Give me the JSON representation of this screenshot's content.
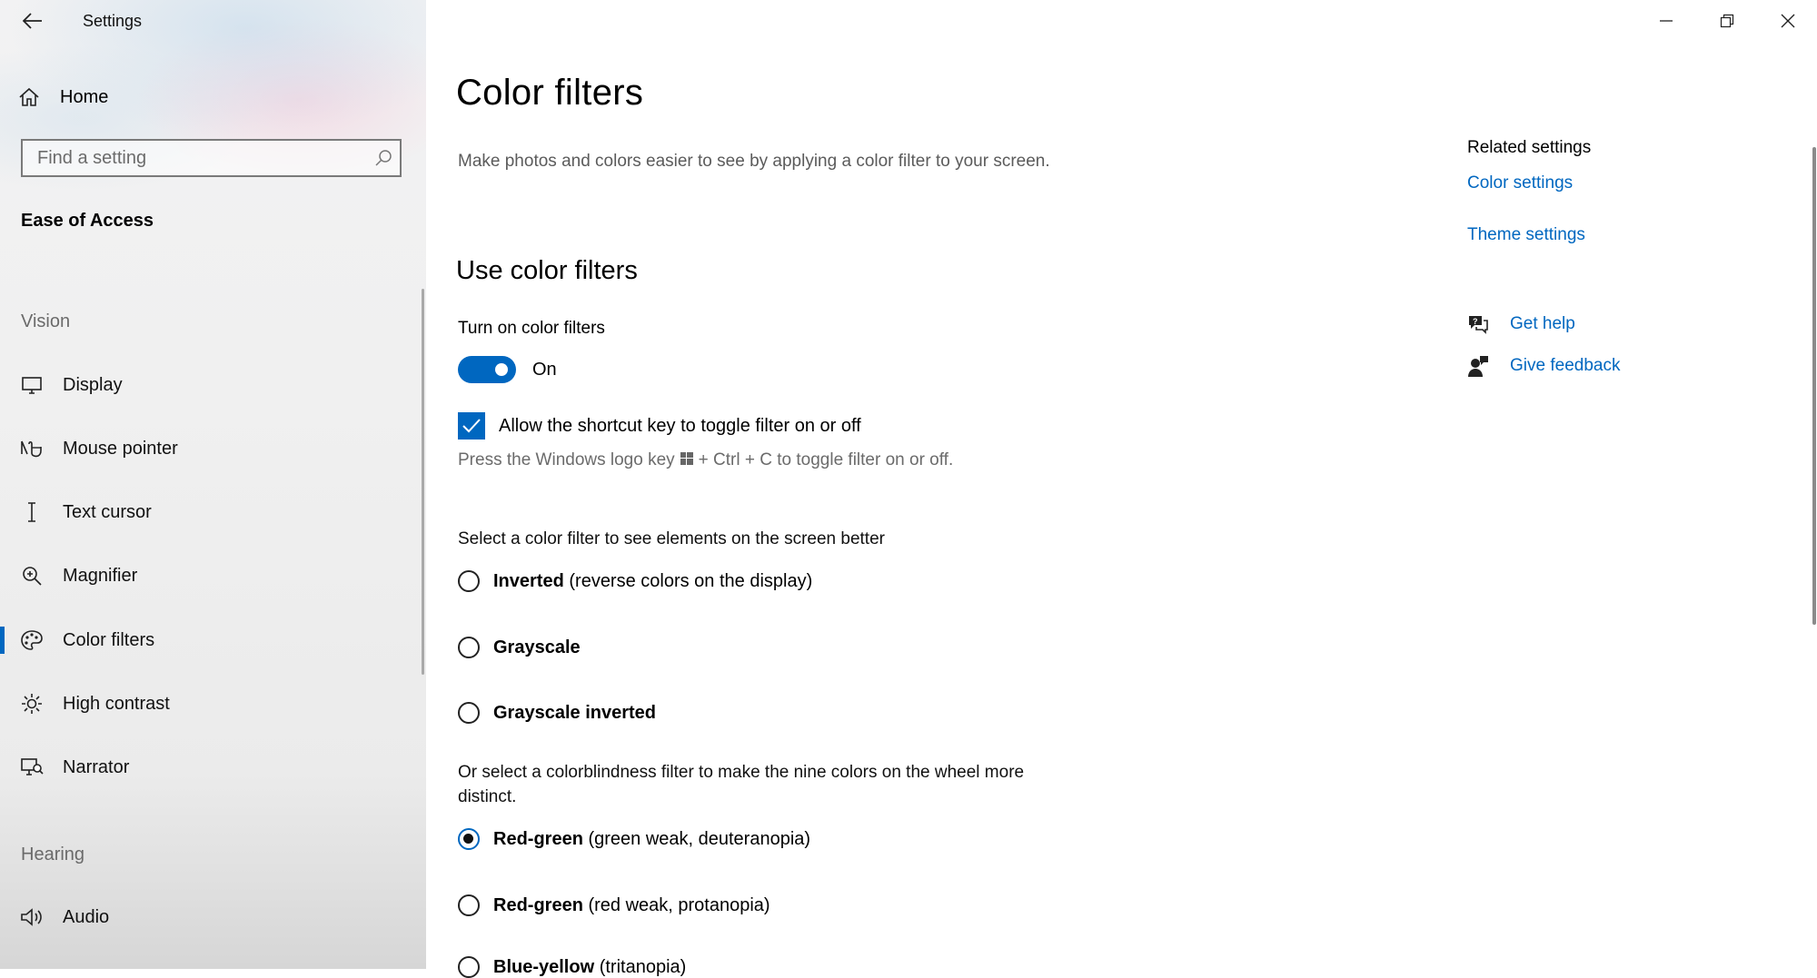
{
  "window": {
    "title": "Settings",
    "controls": [
      "minimize",
      "restore",
      "close"
    ]
  },
  "sidebar": {
    "home_label": "Home",
    "search_placeholder": "Find a setting",
    "section_title": "Ease of Access",
    "groups": [
      {
        "label": "Vision",
        "items": [
          {
            "label": "Display",
            "icon": "display-icon"
          },
          {
            "label": "Mouse pointer",
            "icon": "mouse-pointer-icon"
          },
          {
            "label": "Text cursor",
            "icon": "text-cursor-icon"
          },
          {
            "label": "Magnifier",
            "icon": "magnifier-icon"
          },
          {
            "label": "Color filters",
            "icon": "palette-icon",
            "selected": true
          },
          {
            "label": "High contrast",
            "icon": "sun-icon"
          },
          {
            "label": "Narrator",
            "icon": "narrator-icon"
          }
        ]
      },
      {
        "label": "Hearing",
        "items": [
          {
            "label": "Audio",
            "icon": "speaker-icon"
          }
        ]
      }
    ]
  },
  "main": {
    "title": "Color filters",
    "description": "Make photos and colors easier to see by applying a color filter to your screen.",
    "use_section": {
      "title": "Use color filters",
      "toggle_label": "Turn on color filters",
      "toggle_state": "On",
      "toggle_on": true,
      "checkbox_label": "Allow the shortcut key to toggle filter on or off",
      "checkbox_checked": true,
      "hint_before": "Press the Windows logo key",
      "hint_after": "+ Ctrl + C to toggle filter on or off."
    },
    "filter_group": {
      "header": "Select a color filter to see elements on the screen better",
      "options": [
        {
          "bold": "Inverted",
          "rest": " (reverse colors on the display)",
          "checked": false
        },
        {
          "bold": "Grayscale",
          "rest": "",
          "checked": false
        },
        {
          "bold": "Grayscale inverted",
          "rest": "",
          "checked": false
        }
      ]
    },
    "colorblind_group": {
      "header": "Or select a colorblindness filter to make the nine colors on the wheel more distinct.",
      "options": [
        {
          "bold": "Red-green",
          "rest": " (green weak, deuteranopia)",
          "checked": true
        },
        {
          "bold": "Red-green",
          "rest": " (red weak, protanopia)",
          "checked": false
        },
        {
          "bold": "Blue-yellow",
          "rest": " (tritanopia)",
          "checked": false
        }
      ]
    }
  },
  "related": {
    "header": "Related settings",
    "links": [
      "Color settings",
      "Theme settings"
    ],
    "help": [
      {
        "label": "Get help",
        "icon": "get-help-icon"
      },
      {
        "label": "Give feedback",
        "icon": "give-feedback-icon"
      }
    ]
  },
  "colors": {
    "accent": "#0067c0",
    "link": "#0067c0",
    "muted_text": "#6b6b6b"
  }
}
